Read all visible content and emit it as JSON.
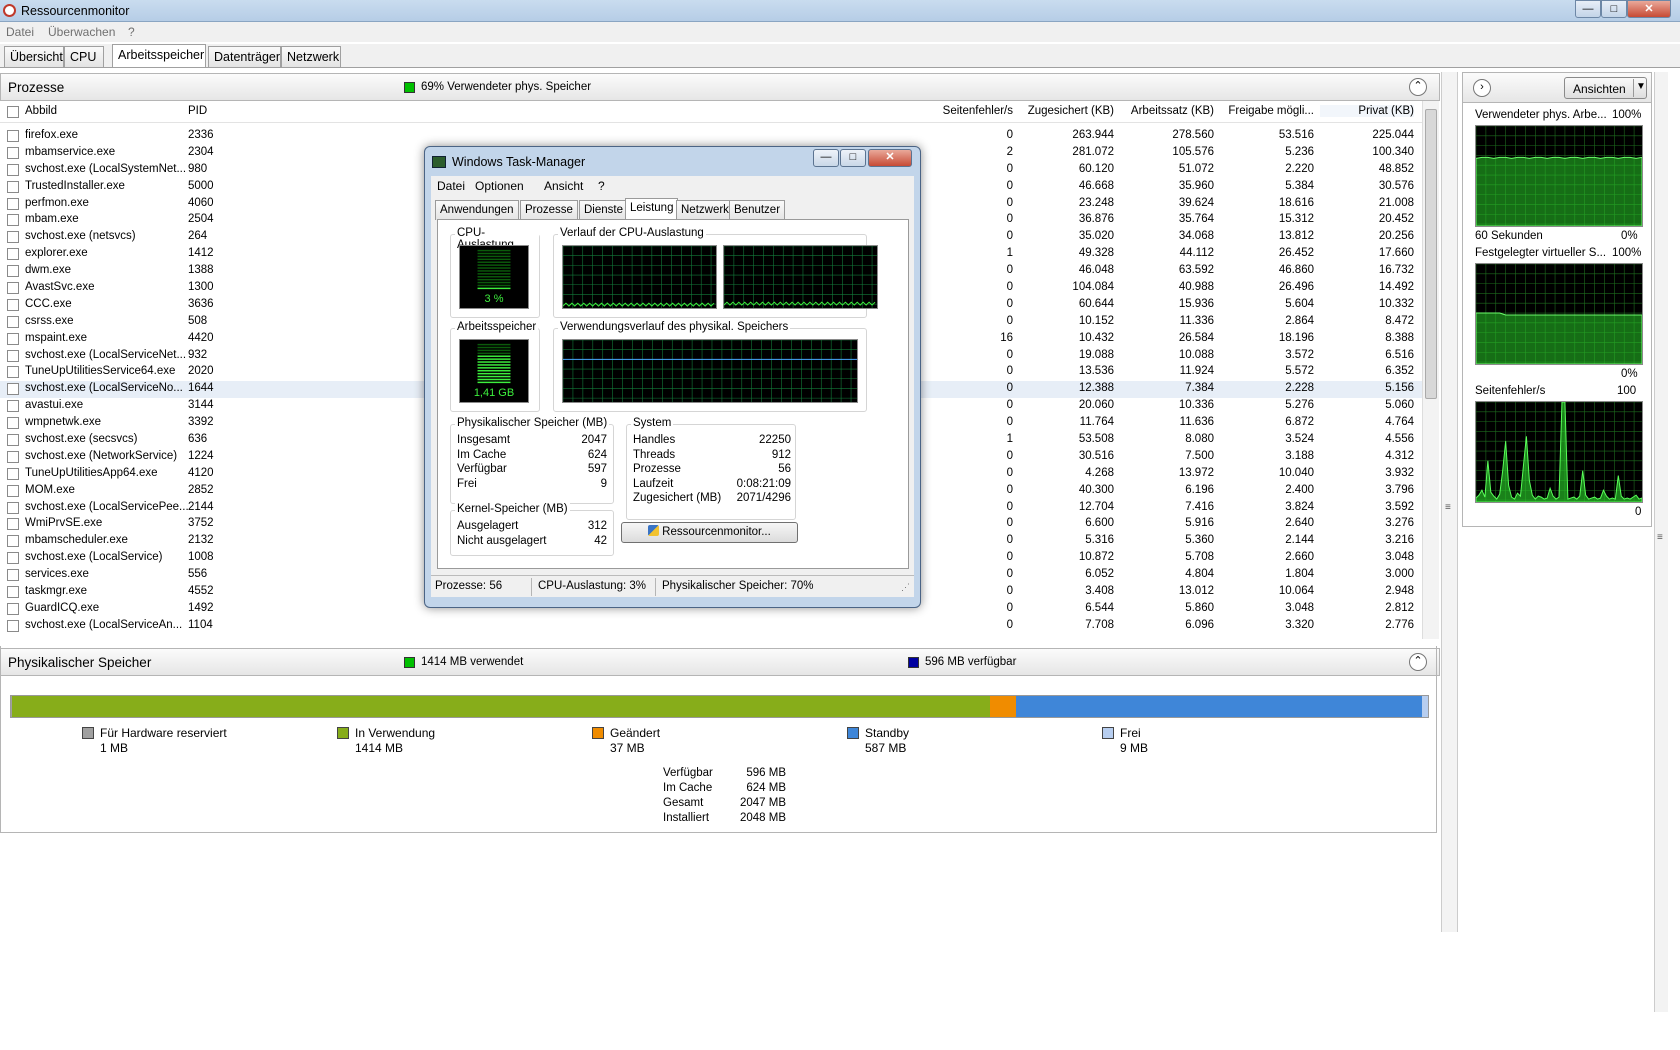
{
  "window": {
    "title": "Ressourcenmonitor"
  },
  "menu": [
    "Datei",
    "Überwachen",
    "?"
  ],
  "tabs": [
    "Übersicht",
    "CPU",
    "Arbeitsspeicher",
    "Datenträger",
    "Netzwerk"
  ],
  "processes": {
    "title": "Prozesse",
    "indicator": "69% Verwendeter phys. Speicher",
    "indicator_color": "#00c000",
    "columns": [
      "Abbild",
      "PID",
      "Seitenfehler/s",
      "Zugesichert (KB)",
      "Arbeitssatz (KB)",
      "Freigabe mögli...",
      "Privat (KB)"
    ],
    "rows": [
      [
        "firefox.exe",
        "2336",
        "0",
        "263.944",
        "278.560",
        "53.516",
        "225.044"
      ],
      [
        "mbamservice.exe",
        "2304",
        "2",
        "281.072",
        "105.576",
        "5.236",
        "100.340"
      ],
      [
        "svchost.exe (LocalSystemNet...",
        "980",
        "0",
        "60.120",
        "51.072",
        "2.220",
        "48.852"
      ],
      [
        "TrustedInstaller.exe",
        "5000",
        "0",
        "46.668",
        "35.960",
        "5.384",
        "30.576"
      ],
      [
        "perfmon.exe",
        "4060",
        "0",
        "23.248",
        "39.624",
        "18.616",
        "21.008"
      ],
      [
        "mbam.exe",
        "2504",
        "0",
        "36.876",
        "35.764",
        "15.312",
        "20.452"
      ],
      [
        "svchost.exe (netsvcs)",
        "264",
        "0",
        "35.020",
        "34.068",
        "13.812",
        "20.256"
      ],
      [
        "explorer.exe",
        "1412",
        "1",
        "49.328",
        "44.112",
        "26.452",
        "17.660"
      ],
      [
        "dwm.exe",
        "1388",
        "0",
        "46.048",
        "63.592",
        "46.860",
        "16.732"
      ],
      [
        "AvastSvc.exe",
        "1300",
        "0",
        "104.084",
        "40.988",
        "26.496",
        "14.492"
      ],
      [
        "CCC.exe",
        "3636",
        "0",
        "60.644",
        "15.936",
        "5.604",
        "10.332"
      ],
      [
        "csrss.exe",
        "508",
        "0",
        "10.152",
        "11.336",
        "2.864",
        "8.472"
      ],
      [
        "mspaint.exe",
        "4420",
        "16",
        "10.432",
        "26.584",
        "18.196",
        "8.388"
      ],
      [
        "svchost.exe (LocalServiceNet...",
        "932",
        "0",
        "19.088",
        "10.088",
        "3.572",
        "6.516"
      ],
      [
        "TuneUpUtilitiesService64.exe",
        "2020",
        "0",
        "13.536",
        "11.924",
        "5.572",
        "6.352"
      ],
      [
        "svchost.exe (LocalServiceNo...",
        "1644",
        "0",
        "12.388",
        "7.384",
        "2.228",
        "5.156"
      ],
      [
        "avastui.exe",
        "3144",
        "0",
        "20.060",
        "10.336",
        "5.276",
        "5.060"
      ],
      [
        "wmpnetwk.exe",
        "3392",
        "0",
        "11.764",
        "11.636",
        "6.872",
        "4.764"
      ],
      [
        "svchost.exe (secsvcs)",
        "636",
        "1",
        "53.508",
        "8.080",
        "3.524",
        "4.556"
      ],
      [
        "svchost.exe (NetworkService)",
        "1224",
        "0",
        "30.516",
        "7.500",
        "3.188",
        "4.312"
      ],
      [
        "TuneUpUtilitiesApp64.exe",
        "4120",
        "0",
        "4.268",
        "13.972",
        "10.040",
        "3.932"
      ],
      [
        "MOM.exe",
        "2852",
        "0",
        "40.300",
        "6.196",
        "2.400",
        "3.796"
      ],
      [
        "svchost.exe (LocalServicePee...",
        "2144",
        "0",
        "12.704",
        "7.416",
        "3.824",
        "3.592"
      ],
      [
        "WmiPrvSE.exe",
        "3752",
        "0",
        "6.600",
        "5.916",
        "2.640",
        "3.276"
      ],
      [
        "mbamscheduler.exe",
        "2132",
        "0",
        "5.316",
        "5.360",
        "2.144",
        "3.216"
      ],
      [
        "svchost.exe (LocalService)",
        "1008",
        "0",
        "10.872",
        "5.708",
        "2.660",
        "3.048"
      ],
      [
        "services.exe",
        "556",
        "0",
        "6.052",
        "4.804",
        "1.804",
        "3.000"
      ],
      [
        "taskmgr.exe",
        "4552",
        "0",
        "3.408",
        "13.012",
        "10.064",
        "2.948"
      ],
      [
        "GuardICQ.exe",
        "1492",
        "0",
        "6.544",
        "5.860",
        "3.048",
        "2.812"
      ],
      [
        "svchost.exe (LocalServiceAn...",
        "1104",
        "0",
        "7.708",
        "6.096",
        "3.320",
        "2.776"
      ]
    ]
  },
  "physical_memory": {
    "title": "Physikalischer Speicher",
    "used_label": "1414 MB verwendet",
    "used_color": "#00c000",
    "available_label": "596 MB verfügbar",
    "available_color": "#0000a0",
    "segments": [
      {
        "name": "Für Hardware reserviert",
        "value": "1 MB",
        "mb": 1,
        "color": "#a0a0a0"
      },
      {
        "name": "In Verwendung",
        "value": "1414 MB",
        "mb": 1414,
        "color": "#87ad1a"
      },
      {
        "name": "Geändert",
        "value": "37 MB",
        "mb": 37,
        "color": "#f08c00"
      },
      {
        "name": "Standby",
        "value": "587 MB",
        "mb": 587,
        "color": "#3f86d8"
      },
      {
        "name": "Frei",
        "value": "9 MB",
        "mb": 9,
        "color": "#b7cef0"
      }
    ],
    "stats": [
      [
        "Verfügbar",
        "596 MB"
      ],
      [
        "Im Cache",
        "624 MB"
      ],
      [
        "Gesamt",
        "2047 MB"
      ],
      [
        "Installiert",
        "2048 MB"
      ]
    ]
  },
  "right_panel": {
    "views_label": "Ansichten",
    "graphs": [
      {
        "title": "Verwendeter phys. Arbe...",
        "max": "100%",
        "footer_left": "60 Sekunden",
        "footer_right": "0%"
      },
      {
        "title": "Festgelegter virtueller S...",
        "max": "100%",
        "footer_left": "",
        "footer_right": "0%"
      },
      {
        "title": "Seitenfehler/s",
        "max": "100",
        "footer_left": "",
        "footer_right": "0"
      }
    ]
  },
  "task_manager": {
    "title": "Windows Task-Manager",
    "menu": [
      "Datei",
      "Optionen",
      "Ansicht",
      "?"
    ],
    "tabs": [
      "Anwendungen",
      "Prozesse",
      "Dienste",
      "Leistung",
      "Netzwerk",
      "Benutzer"
    ],
    "cpu_label": "CPU-Auslastung",
    "cpu_value": "3 %",
    "cpu_history_label": "Verlauf der CPU-Auslastung",
    "mem_label": "Arbeitsspeicher",
    "mem_value": "1,41 GB",
    "mem_history_label": "Verwendungsverlauf des physikal. Speichers",
    "phys_title": "Physikalischer Speicher (MB)",
    "phys": [
      [
        "Insgesamt",
        "2047"
      ],
      [
        "Im Cache",
        "624"
      ],
      [
        "Verfügbar",
        "597"
      ],
      [
        "Frei",
        "9"
      ]
    ],
    "system_title": "System",
    "system": [
      [
        "Handles",
        "22250"
      ],
      [
        "Threads",
        "912"
      ],
      [
        "Prozesse",
        "56"
      ],
      [
        "Laufzeit",
        "0:08:21:09"
      ],
      [
        "Zugesichert (MB)",
        "2071/4296"
      ]
    ],
    "kernel_title": "Kernel-Speicher (MB)",
    "kernel": [
      [
        "Ausgelagert",
        "312"
      ],
      [
        "Nicht ausgelagert",
        "42"
      ]
    ],
    "resmon_button": "Ressourcenmonitor...",
    "status": [
      "Prozesse: 56",
      "CPU-Auslastung: 3%",
      "Physikalischer Speicher: 70%"
    ]
  }
}
